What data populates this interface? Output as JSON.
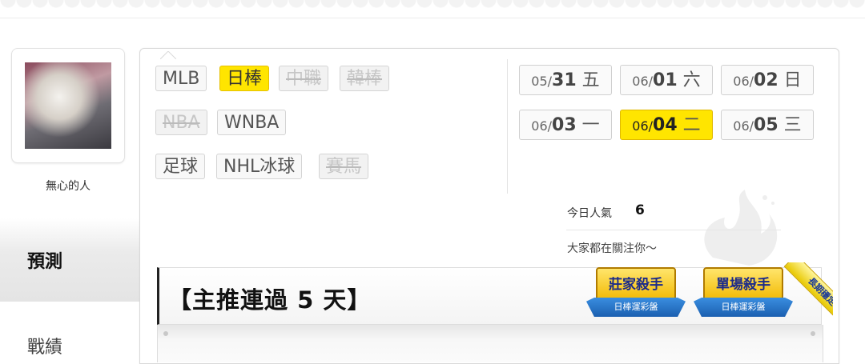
{
  "profile": {
    "username": "無心的人"
  },
  "side_tabs": {
    "predict": "預測",
    "record": "戰績"
  },
  "sports": [
    {
      "label": "MLB",
      "state": "normal"
    },
    {
      "label": "日棒",
      "state": "active"
    },
    {
      "label": "中職",
      "state": "disabled"
    },
    {
      "label": "韓棒",
      "state": "disabled"
    },
    {
      "label": "NBA",
      "state": "disabled"
    },
    {
      "label": "WNBA",
      "state": "normal"
    },
    {
      "label": "足球",
      "state": "normal"
    },
    {
      "label": "NHL冰球",
      "state": "normal"
    },
    {
      "label": "賽馬",
      "state": "disabled"
    }
  ],
  "dates": [
    {
      "md": "05/",
      "dd": "31",
      "dow": "五",
      "active": false
    },
    {
      "md": "06/",
      "dd": "01",
      "dow": "六",
      "active": false
    },
    {
      "md": "06/",
      "dd": "02",
      "dow": "日",
      "active": false
    },
    {
      "md": "06/",
      "dd": "03",
      "dow": "一",
      "active": false
    },
    {
      "md": "06/",
      "dd": "04",
      "dow": "二",
      "active": true
    },
    {
      "md": "06/",
      "dd": "05",
      "dow": "三",
      "active": false
    }
  ],
  "popularity": {
    "label": "今日人氣",
    "value": "6",
    "follow_text": "大家都在關注你～"
  },
  "banner": {
    "title": "【主推連過 5 天】"
  },
  "badges": [
    {
      "title": "莊家殺手",
      "subtitle": "日棒運彩盤"
    },
    {
      "title": "單場殺手",
      "subtitle": "日棒運彩盤"
    }
  ],
  "corner_tag": "長期穩定",
  "colors": {
    "accent_yellow": "#ffe500",
    "badge_blue": "#1b5fb0"
  }
}
